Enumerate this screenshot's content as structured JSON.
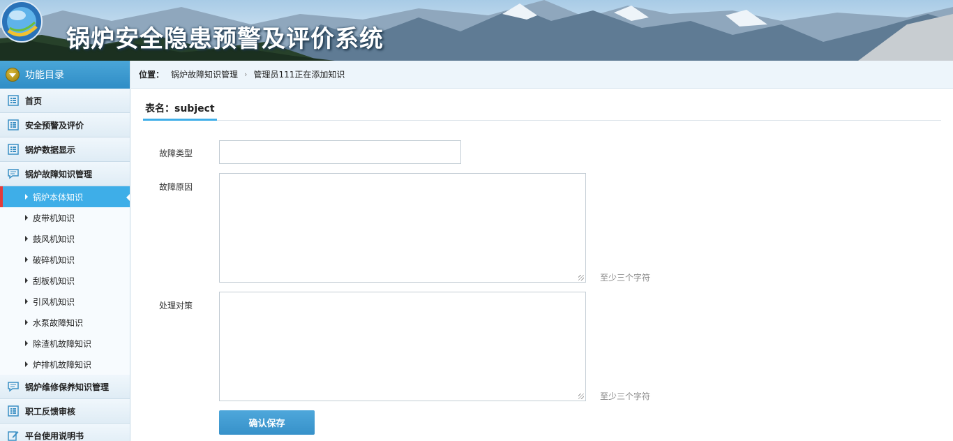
{
  "header": {
    "system_title": "锅炉安全隐患预警及评价系统"
  },
  "sidebar": {
    "heading": "功能目录",
    "items": [
      {
        "label": "首页",
        "icon": "list-icon"
      },
      {
        "label": "安全预警及评价",
        "icon": "list-icon"
      },
      {
        "label": "锅炉数据显示",
        "icon": "list-icon"
      },
      {
        "label": "锅炉故障知识管理",
        "icon": "chat-icon"
      }
    ],
    "sub_items": [
      {
        "label": "锅炉本体知识",
        "active": true
      },
      {
        "label": "皮带机知识"
      },
      {
        "label": "鼓风机知识"
      },
      {
        "label": "破碎机知识"
      },
      {
        "label": "刮板机知识"
      },
      {
        "label": "引风机知识"
      },
      {
        "label": "水泵故障知识"
      },
      {
        "label": "除渣机故障知识"
      },
      {
        "label": "炉排机故障知识"
      }
    ],
    "items_after": [
      {
        "label": "锅炉维修保养知识管理",
        "icon": "chat-icon"
      },
      {
        "label": "职工反馈审核",
        "icon": "list-icon"
      },
      {
        "label": "平台使用说明书",
        "icon": "edit-icon"
      }
    ]
  },
  "breadcrumb": {
    "position_label": "位置：",
    "level1": "锅炉故障知识管理",
    "level2": "管理员111正在添加知识"
  },
  "form": {
    "table_name": "表名：subject",
    "fault_type_label": "故障类型",
    "fault_type_value": "",
    "fault_cause_label": "故障原因",
    "fault_cause_value": "",
    "fault_cause_hint": "至少三个字符",
    "solution_label": "处理对策",
    "solution_value": "",
    "solution_hint": "至少三个字符",
    "submit_label": "确认保存"
  }
}
